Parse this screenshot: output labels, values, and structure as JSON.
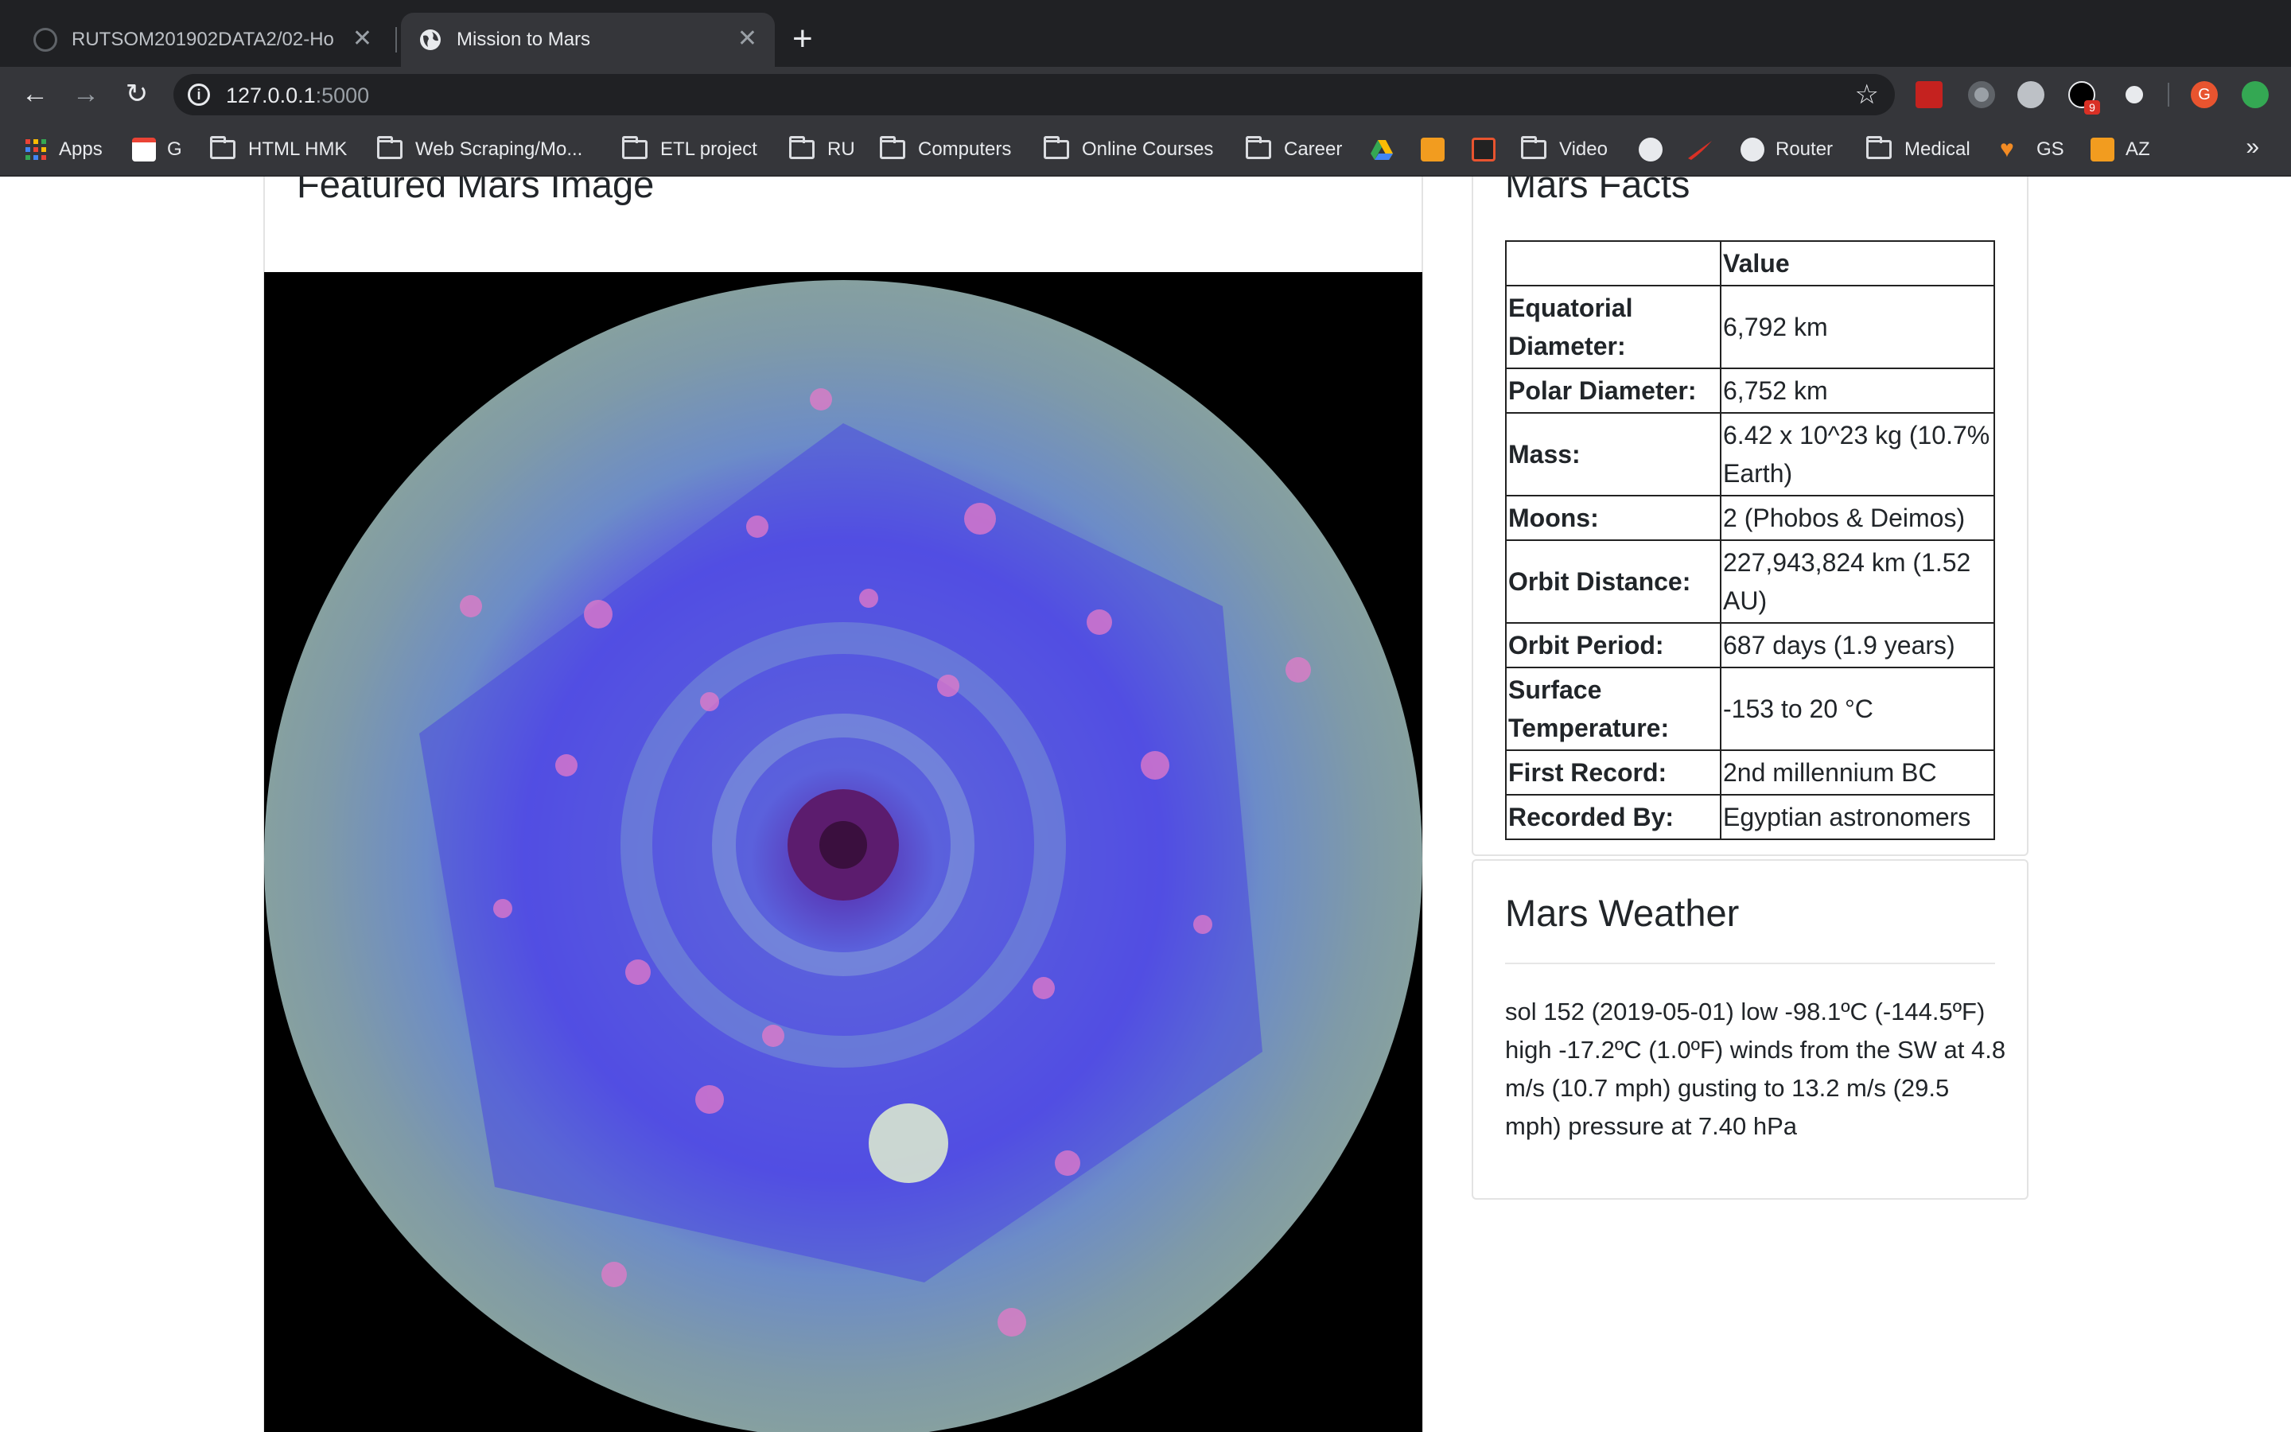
{
  "browser": {
    "tabs": [
      {
        "title": "RUTSOM201902DATA2/02-Ho",
        "active": false
      },
      {
        "title": "Mission to Mars",
        "active": true
      }
    ],
    "address": {
      "host": "127.0.0.1",
      "port": ":5000"
    },
    "bookmarks": [
      {
        "label": "Apps",
        "icon": "apps-grid-icon"
      },
      {
        "label": "G",
        "icon": "gmail-icon"
      },
      {
        "label": "HTML HMK",
        "icon": "folder-icon"
      },
      {
        "label": "Web Scraping/Mo...",
        "icon": "folder-icon"
      },
      {
        "label": "ETL project",
        "icon": "folder-icon"
      },
      {
        "label": "RU",
        "icon": "folder-icon"
      },
      {
        "label": "Computers",
        "icon": "folder-icon"
      },
      {
        "label": "Online Courses",
        "icon": "folder-icon"
      },
      {
        "label": "Career",
        "icon": "folder-icon"
      },
      {
        "label": "Video",
        "icon": "folder-icon"
      },
      {
        "label": "Router",
        "icon": "globe-icon"
      },
      {
        "label": "Medical",
        "icon": "folder-icon"
      },
      {
        "label": "GS",
        "icon": "heart-icon"
      },
      {
        "label": "AZ",
        "icon": "amazon-icon"
      }
    ],
    "extension_badge": "9",
    "profile_initial": "G"
  },
  "featured": {
    "heading": "Featured Mars Image"
  },
  "facts": {
    "heading": "Mars Facts",
    "header_value": "Value",
    "rows": [
      {
        "key": "Equatorial Diameter:",
        "value": "6,792 km"
      },
      {
        "key": "Polar Diameter:",
        "value": "6,752 km"
      },
      {
        "key": "Mass:",
        "value": "6.42 x 10^23 kg (10.7% Earth)"
      },
      {
        "key": "Moons:",
        "value": "2 (Phobos & Deimos)"
      },
      {
        "key": "Orbit Distance:",
        "value": "227,943,824 km (1.52 AU)"
      },
      {
        "key": "Orbit Period:",
        "value": "687 days (1.9 years)"
      },
      {
        "key": "Surface Temperature:",
        "value": "-153 to 20 °C"
      },
      {
        "key": "First Record:",
        "value": "2nd millennium BC"
      },
      {
        "key": "Recorded By:",
        "value": "Egyptian astronomers"
      }
    ]
  },
  "weather": {
    "heading": "Mars Weather",
    "text": "sol 152 (2019-05-01) low -98.1ºC (-144.5ºF) high -17.2ºC (1.0ºF) winds from the SW at 4.8 m/s (10.7 mph) gusting to 13.2 m/s (29.5 mph) pressure at 7.40 hPa"
  }
}
